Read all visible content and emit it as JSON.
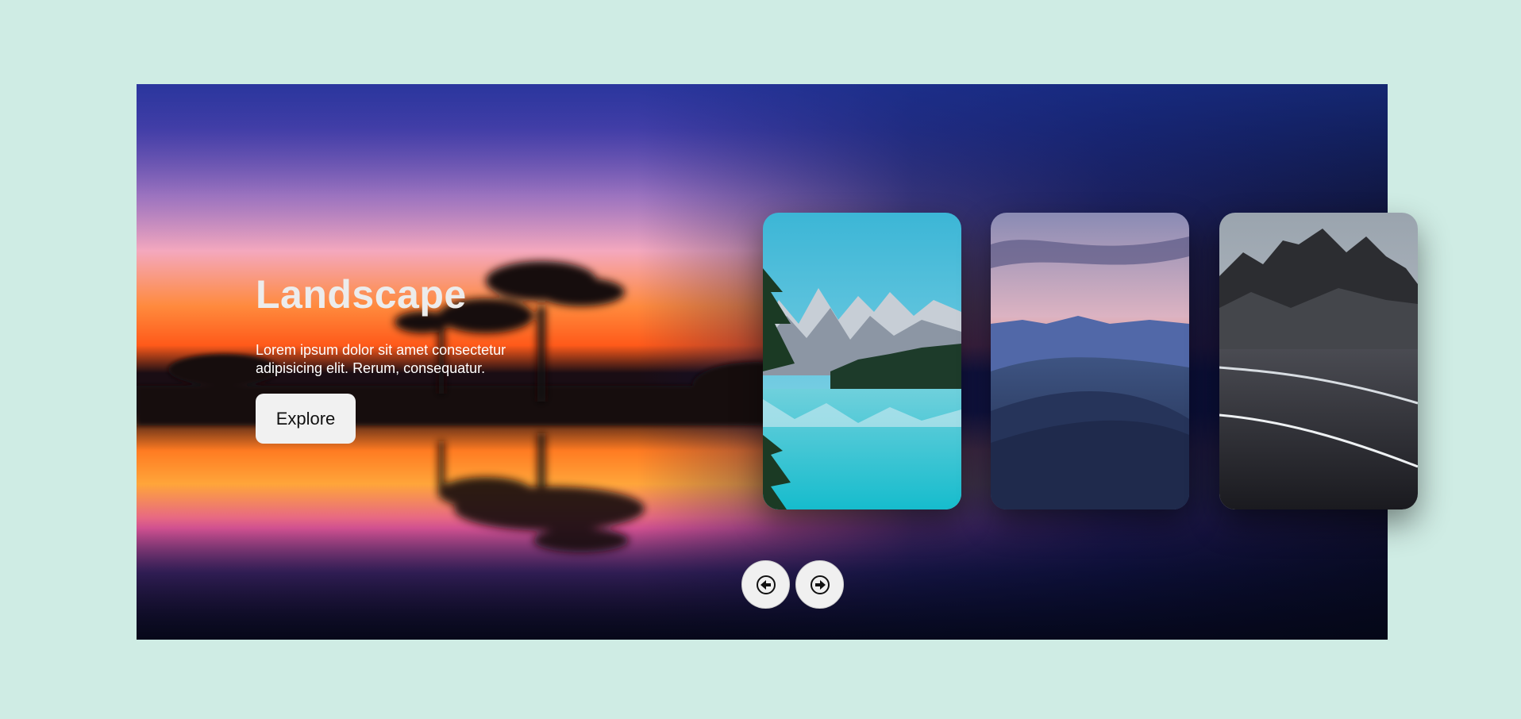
{
  "hero": {
    "title": "Landscape",
    "description": "Lorem ipsum dolor sit amet consectetur adipisicing elit. Rerum, consequatur.",
    "button_label": "Explore"
  },
  "cards": [
    {
      "icon": "mountain-lake-thumbnail"
    },
    {
      "icon": "desert-dunes-thumbnail"
    },
    {
      "icon": "black-sand-beach-thumbnail"
    }
  ],
  "navigation": {
    "prev_icon": "arrow-left-circle-icon",
    "next_icon": "arrow-right-circle-icon"
  },
  "colors": {
    "page_background": "#cfece4",
    "button_background": "#f1f1f1"
  }
}
